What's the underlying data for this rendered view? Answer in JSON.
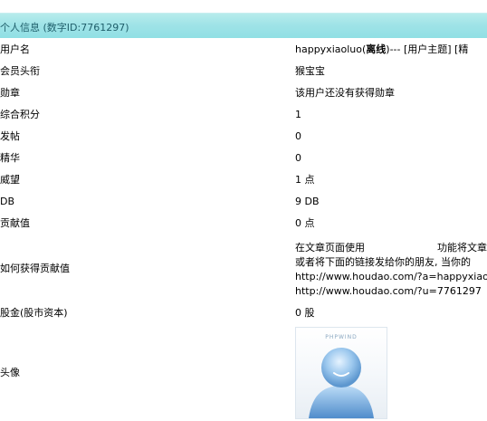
{
  "header": {
    "title": "个人信息 (数字ID:7761297)"
  },
  "profile": {
    "username": {
      "label": "用户名",
      "name": "happyxiaoluo",
      "status": "离线",
      "links": ")--- [用户主题] [精"
    },
    "title": {
      "label": "会员头衔",
      "value": "猴宝宝"
    },
    "medal": {
      "label": "勋章",
      "value": "该用户还没有获得勋章"
    },
    "score": {
      "label": "综合积分",
      "value": "1"
    },
    "posts": {
      "label": "发帖",
      "value": "0"
    },
    "digest": {
      "label": "精华",
      "value": "0"
    },
    "prestige": {
      "label": "威望",
      "value": "1 点"
    },
    "db": {
      "label": "DB",
      "value": "9 DB"
    },
    "contribution": {
      "label": "贡献值",
      "value": "0 点"
    },
    "howto": {
      "label": "如何获得贡献值",
      "line1a": "在文章页面使用",
      "line1b": "功能将文章推荐",
      "line2": "或者将下面的链接发给你的朋友, 当你的",
      "line3": "http://www.houdao.com/?a=happyxiao",
      "line4": "http://www.houdao.com/?u=7761297"
    },
    "shares": {
      "label": "股金(股市资本)",
      "value": "0 股"
    },
    "avatar": {
      "label": "头像",
      "brand": "PHPWIND"
    }
  },
  "colors": {
    "header_bg": "#9fe3e7",
    "header_text": "#1f5e6a",
    "row_border": "#c9dde4"
  }
}
